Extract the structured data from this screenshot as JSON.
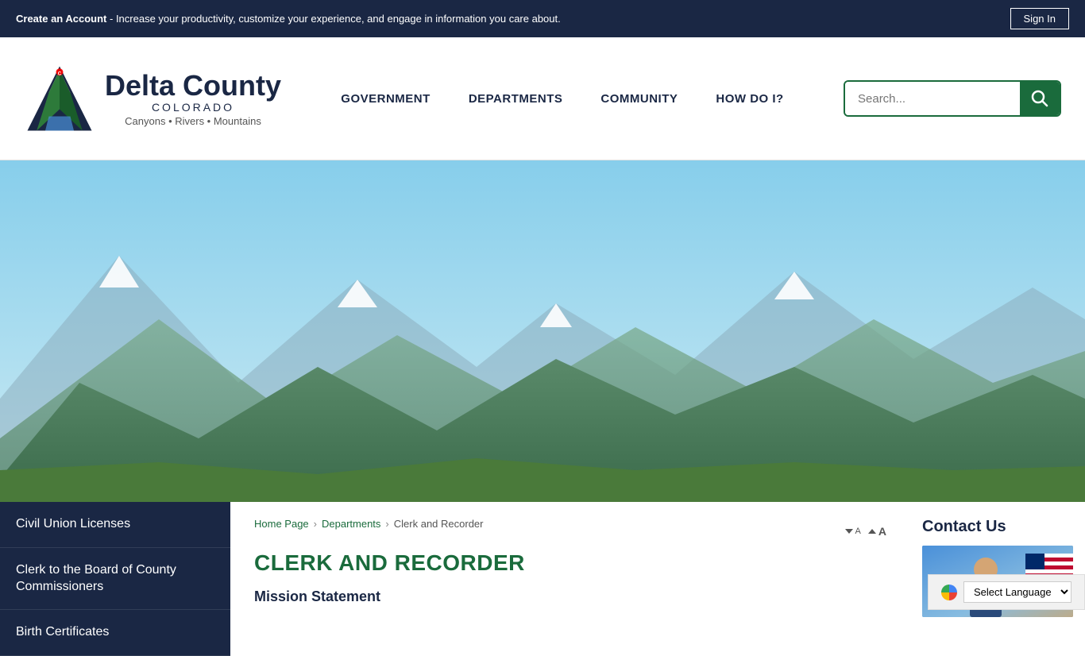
{
  "topBanner": {
    "createAccountLabel": "Create an Account",
    "bannerText": " - Increase your productivity, customize your experience, and engage in information you care about.",
    "signInLabel": "Sign In"
  },
  "header": {
    "logoTitle": "Delta County",
    "logoState": "COLORADO",
    "logoTagline": "Canyons • Rivers • Mountains",
    "nav": [
      {
        "id": "government",
        "label": "GOVERNMENT"
      },
      {
        "id": "departments",
        "label": "DEPARTMENTS"
      },
      {
        "id": "community",
        "label": "COMMUNITY"
      },
      {
        "id": "how-do-i",
        "label": "HOW DO I?"
      }
    ],
    "searchPlaceholder": "Search..."
  },
  "sidebar": {
    "items": [
      {
        "id": "civil-union-licenses",
        "label": "Civil Union Licenses"
      },
      {
        "id": "clerk-to-board",
        "label": "Clerk to the Board of County Commissioners"
      },
      {
        "id": "birth-certificates",
        "label": "Birth Certificates"
      }
    ]
  },
  "breadcrumb": {
    "items": [
      {
        "label": "Home Page",
        "href": "#"
      },
      {
        "label": "Departments",
        "href": "#"
      },
      {
        "label": "Clerk and Recorder",
        "href": "#"
      }
    ]
  },
  "main": {
    "pageTitle": "CLERK AND RECORDER",
    "missionStatementLabel": "Mission Statement"
  },
  "rightSidebar": {
    "contactUsTitle": "Contact Us"
  },
  "fontControls": {
    "decreaseLabel": "A",
    "increaseLabel": "A"
  },
  "translate": {
    "selectLabel": "Select Language"
  }
}
